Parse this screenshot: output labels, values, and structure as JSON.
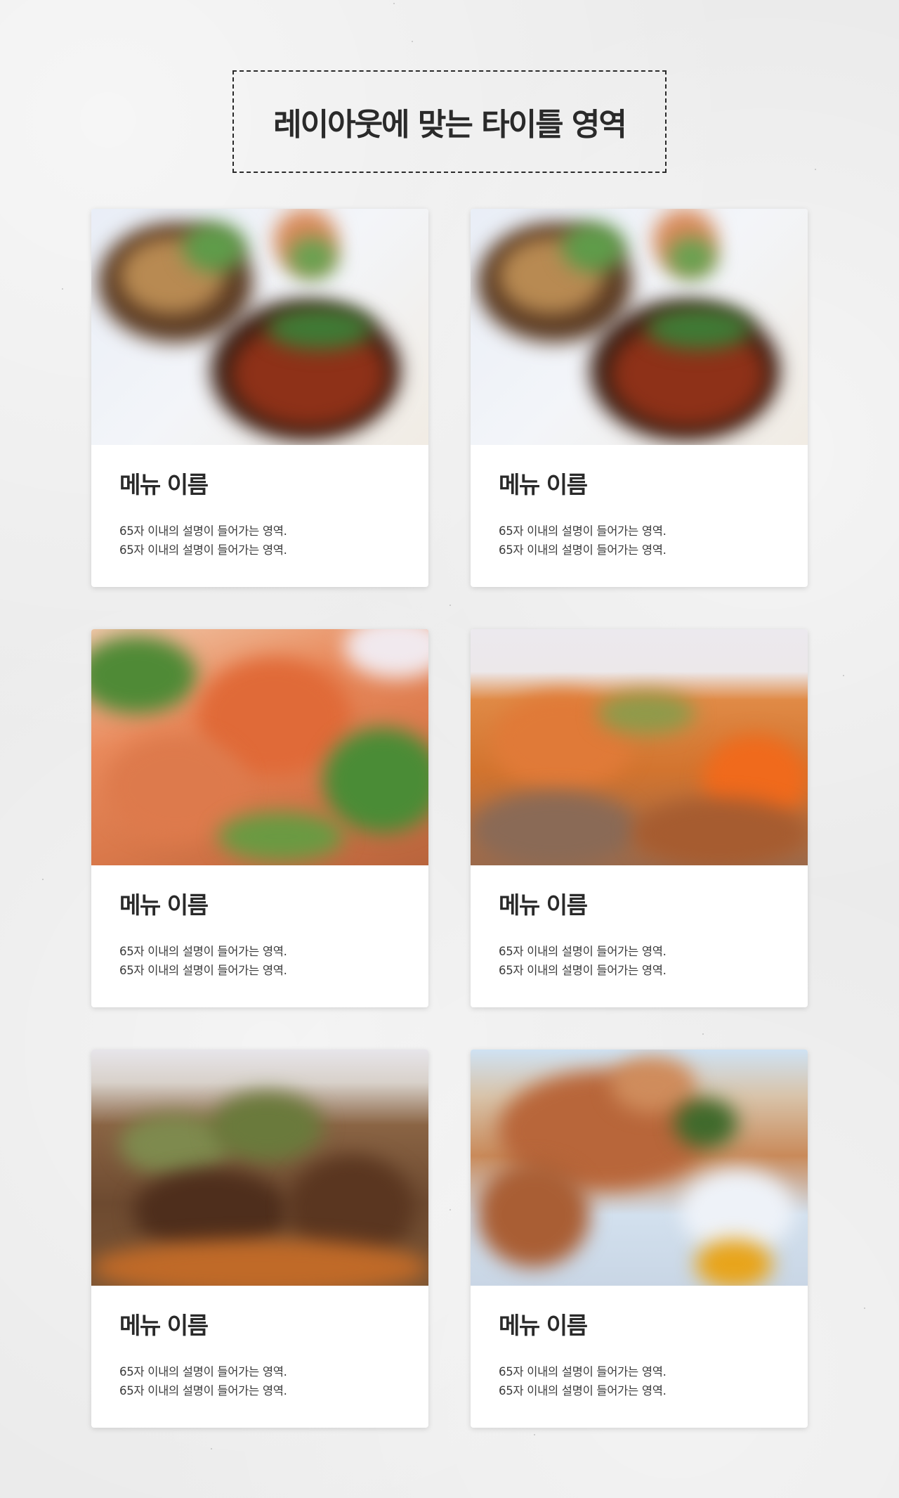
{
  "header": {
    "title": "레이아웃에 맞는 타이틀 영역"
  },
  "menu": {
    "items": [
      {
        "name": "메뉴 이름",
        "desc_line1": "65자 이내의 설명이 들어가는 영역.",
        "desc_line2": "65자 이내의 설명이 들어가는 영역.",
        "photo": "food-photo"
      },
      {
        "name": "메뉴 이름",
        "desc_line1": "65자 이내의 설명이 들어가는 영역.",
        "desc_line2": "65자 이내의 설명이 들어가는 영역.",
        "photo": "food-photo"
      },
      {
        "name": "메뉴 이름",
        "desc_line1": "65자 이내의 설명이 들어가는 영역.",
        "desc_line2": "65자 이내의 설명이 들어가는 영역.",
        "photo": "food-photo"
      },
      {
        "name": "메뉴 이름",
        "desc_line1": "65자 이내의 설명이 들어가는 영역.",
        "desc_line2": "65자 이내의 설명이 들어가는 영역.",
        "photo": "food-photo"
      },
      {
        "name": "메뉴 이름",
        "desc_line1": "65자 이내의 설명이 들어가는 영역.",
        "desc_line2": "65자 이내의 설명이 들어가는 영역.",
        "photo": "food-photo"
      },
      {
        "name": "메뉴 이름",
        "desc_line1": "65자 이내의 설명이 들어가는 영역.",
        "desc_line2": "65자 이내의 설명이 들어가는 영역.",
        "photo": "food-photo"
      }
    ]
  },
  "colors": {
    "background": "#ebebeb",
    "card": "#ffffff",
    "text": "#2a2a2a"
  }
}
